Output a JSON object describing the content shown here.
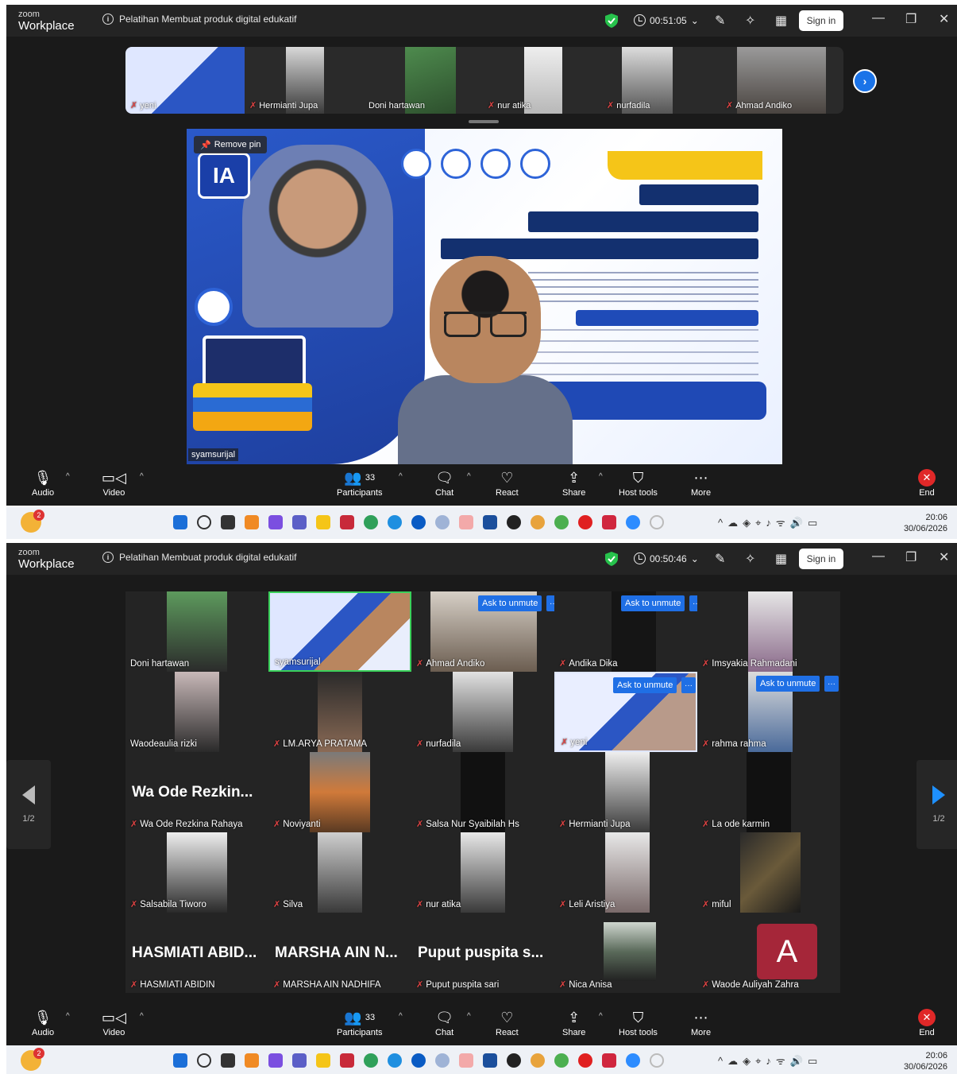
{
  "window": {
    "brand_small": "zoom",
    "brand_large": "Workplace",
    "meeting_title": "Pelatihan Membuat produk digital edukatif",
    "sign_in": "Sign in"
  },
  "panel1": {
    "timer": "00:51:05",
    "thumbnails": [
      {
        "name": "yeni",
        "muted": true
      },
      {
        "name": "Hermianti Jupa",
        "muted": true
      },
      {
        "name": "Doni hartawan",
        "muted": false
      },
      {
        "name": "nur atika",
        "muted": true
      },
      {
        "name": "nurfadila",
        "muted": true
      },
      {
        "name": "Ahmad Andiko",
        "muted": true
      }
    ],
    "remove_pin": "Remove pin",
    "speaker_name": "syamsurijal",
    "slide_badge": "IA"
  },
  "panel2": {
    "timer": "00:50:46",
    "page_left": "1/2",
    "page_right": "1/2",
    "ask_unmute": "Ask to unmute",
    "more_dots": "···",
    "tiles": [
      {
        "name": "Doni hartawan",
        "muted": false
      },
      {
        "name": "syamsurijal",
        "muted": false
      },
      {
        "name": "Ahmad Andiko",
        "muted": true
      },
      {
        "name": "Andika Dika",
        "muted": true
      },
      {
        "name": "Imsyakia Rahmadani",
        "muted": true
      },
      {
        "name": "Waodeaulia rizki",
        "muted": false
      },
      {
        "name": "LM.ARYA PRATAMA",
        "muted": true
      },
      {
        "name": "nurfadila",
        "muted": true
      },
      {
        "name": "yeni",
        "muted": true
      },
      {
        "name": "rahma rahma",
        "muted": true
      },
      {
        "name": "Wa Ode Rezkina Rahaya",
        "muted": true,
        "big": "Wa Ode Rezkin..."
      },
      {
        "name": "Noviyanti",
        "muted": true
      },
      {
        "name": "Salsa Nur Syaibilah Hs",
        "muted": true
      },
      {
        "name": "Hermianti Jupa",
        "muted": true
      },
      {
        "name": "La ode karmin",
        "muted": true
      },
      {
        "name": "Salsabila Tiworo",
        "muted": true
      },
      {
        "name": "Silva",
        "muted": true
      },
      {
        "name": "nur atika",
        "muted": true
      },
      {
        "name": "Leli Aristiya",
        "muted": true
      },
      {
        "name": "miful",
        "muted": true
      },
      {
        "name": "HASMIATI ABIDIN",
        "muted": true,
        "big": "HASMIATI ABID..."
      },
      {
        "name": "MARSHA AIN NADHIFA",
        "muted": true,
        "big": "MARSHA AIN N..."
      },
      {
        "name": "Puput puspita sari",
        "muted": true,
        "big": "Puput puspita s..."
      },
      {
        "name": "Nica Anisa",
        "muted": true
      },
      {
        "name": "Waode Auliyah Zahra",
        "muted": true,
        "avatar": "A"
      }
    ]
  },
  "toolbar": {
    "audio": "Audio",
    "video": "Video",
    "participants": "Participants",
    "participants_count": "33",
    "chat": "Chat",
    "react": "React",
    "share": "Share",
    "host_tools": "Host tools",
    "more": "More",
    "end": "End"
  },
  "taskbar": {
    "time": "20:06",
    "date": "30/06/2026",
    "notifications": "2"
  },
  "colors": {
    "accent": "#1f6fe5",
    "end_red": "#e02828",
    "mute_red": "#e04444",
    "active_border": "#3ad05a"
  }
}
